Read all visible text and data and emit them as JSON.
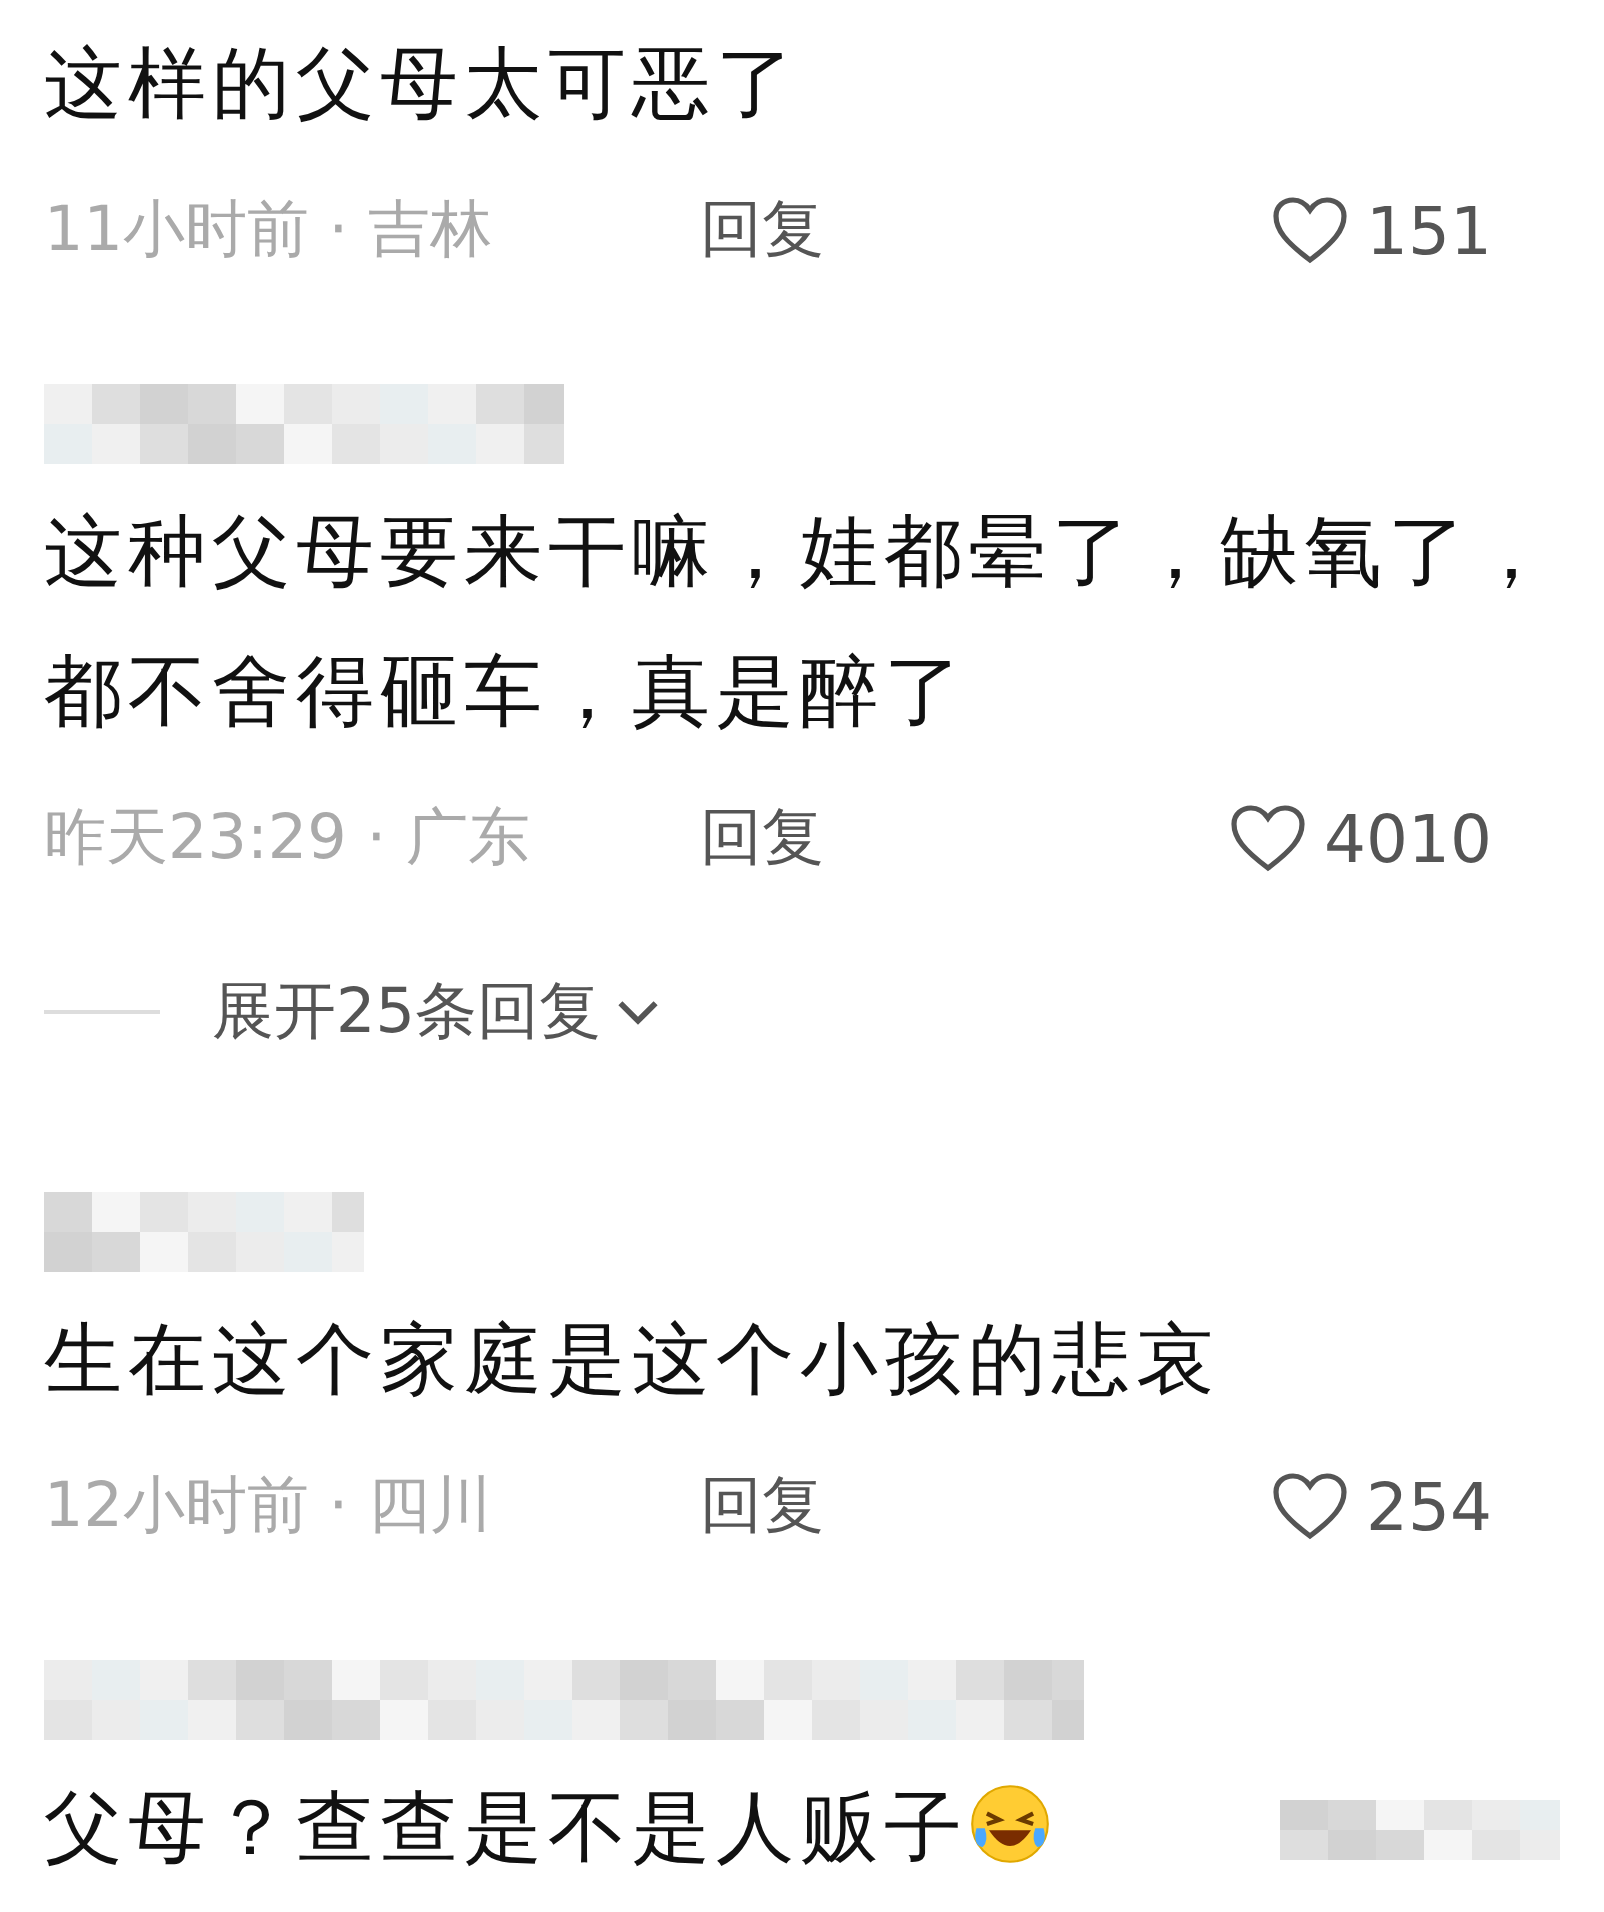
{
  "comments": [
    {
      "author_blurred": false,
      "text": "这样的父母太可恶了",
      "meta": "11小时前 · 吉林",
      "reply": "回复",
      "likes": "151"
    },
    {
      "author_blurred": true,
      "text": "这种父母要来干嘛，娃都晕了，缺氧了，都不舍得砸车，真是醉了",
      "meta": "昨天23:29 · 广东",
      "reply": "回复",
      "likes": "4010",
      "replies_toggle": "展开25条回复"
    },
    {
      "author_blurred": true,
      "text": "生在这个家庭是这个小孩的悲哀",
      "meta": "12小时前 · 四川",
      "reply": "回复",
      "likes": "254"
    },
    {
      "author_blurred": true,
      "text": "父母？查查是不是人贩子",
      "emoji": true,
      "trailing_blurred": true
    }
  ]
}
